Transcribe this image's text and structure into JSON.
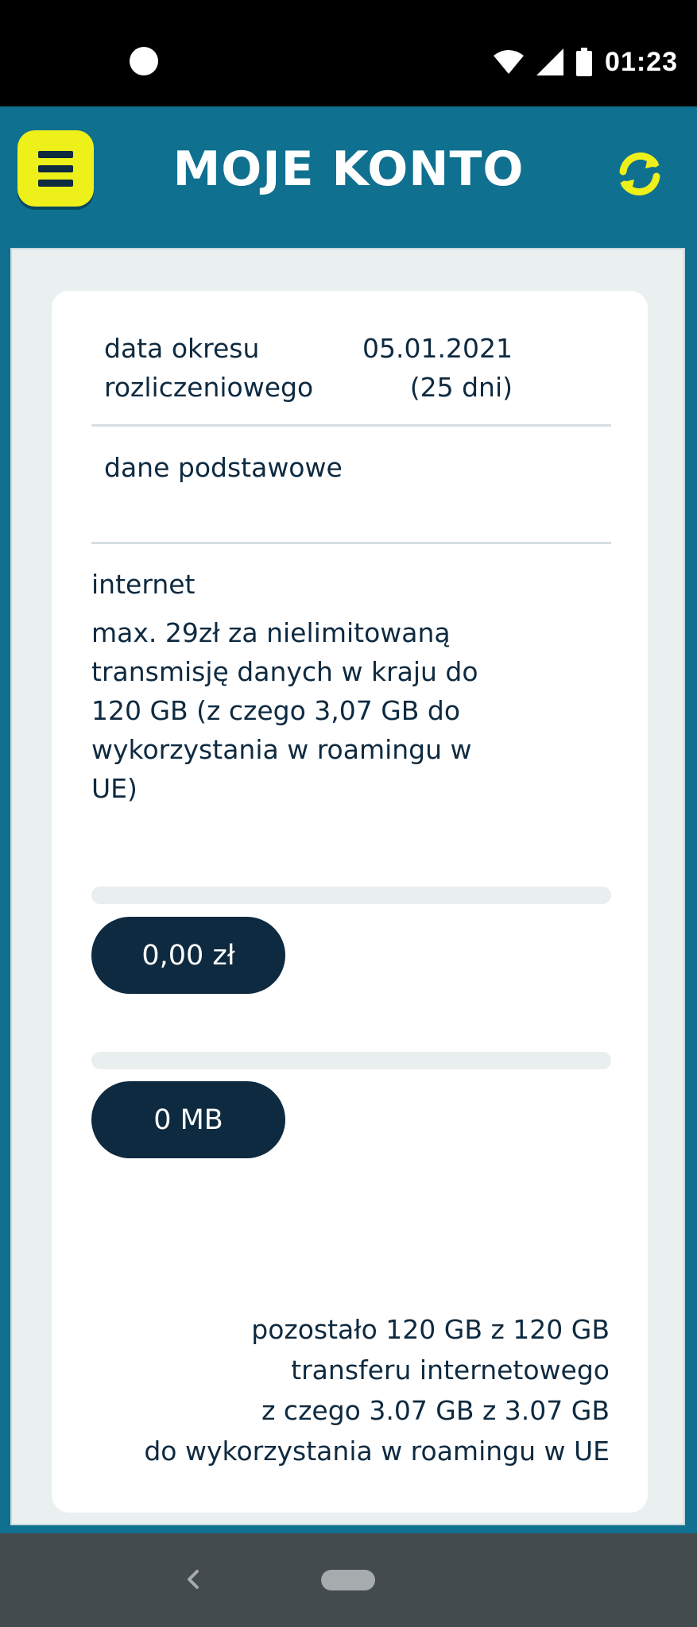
{
  "status_bar": {
    "time": "01:23",
    "icons": [
      "notification-dot-icon",
      "wifi-icon",
      "signal-icon",
      "battery-icon"
    ]
  },
  "header": {
    "title": "MOJE KONTO",
    "menu_icon": "menu-icon",
    "refresh_icon": "refresh-icon"
  },
  "account": {
    "billing_label": "data okresu rozliczeniowego",
    "billing_value": "05.01.2021 (25 dni)",
    "basic_label": "dane podstawowe",
    "internet_label": "internet",
    "internet_description": "max. 29zł za nielimitowaną transmisję danych w kraju do 120 GB (z czego 3,07 GB do wykorzystania w roamingu w UE)",
    "cost_value": "0,00 zł",
    "cost_usage_fraction": 0,
    "data_value": "0 MB",
    "data_usage_fraction": 0,
    "summary": [
      "pozostało 120 GB z 120 GB",
      "transferu internetowego",
      "z czego 3.07 GB z 3.07 GB",
      "do wykorzystania w roamingu w UE"
    ]
  },
  "nav_bar": {
    "back_icon": "back-icon",
    "home_icon": "home-pill-icon"
  },
  "colors": {
    "brand_teal": "#0f7090",
    "accent_yellow": "#eef01a",
    "dark_navy": "#0e2a40",
    "panel_gray": "#eaefef"
  }
}
